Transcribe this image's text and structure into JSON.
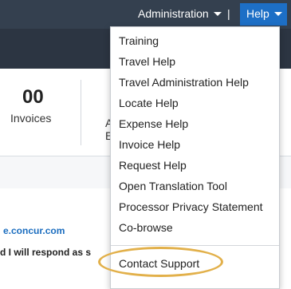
{
  "topnav": {
    "administration_label": "Administration",
    "divider": "|",
    "help_label": "Help"
  },
  "dashboard": {
    "invoice_count": "00",
    "invoice_label": "Invoices",
    "next_tile_line1": "A",
    "next_tile_line2": "E"
  },
  "content": {
    "email_fragment": "e.concur.com",
    "respond_fragment": "d I will respond as s"
  },
  "help_menu": {
    "items": [
      "Training",
      "Travel Help",
      "Travel Administration Help",
      "Locate Help",
      "Expense Help",
      "Invoice Help",
      "Request Help",
      "Open Translation Tool",
      "Processor Privacy Statement",
      "Co-browse"
    ],
    "contact_support": "Contact Support"
  },
  "colors": {
    "topbar": "#34404f",
    "help_active": "#1d6fc6",
    "link": "#1b6dbf",
    "highlight_ring": "#e2b04a"
  }
}
